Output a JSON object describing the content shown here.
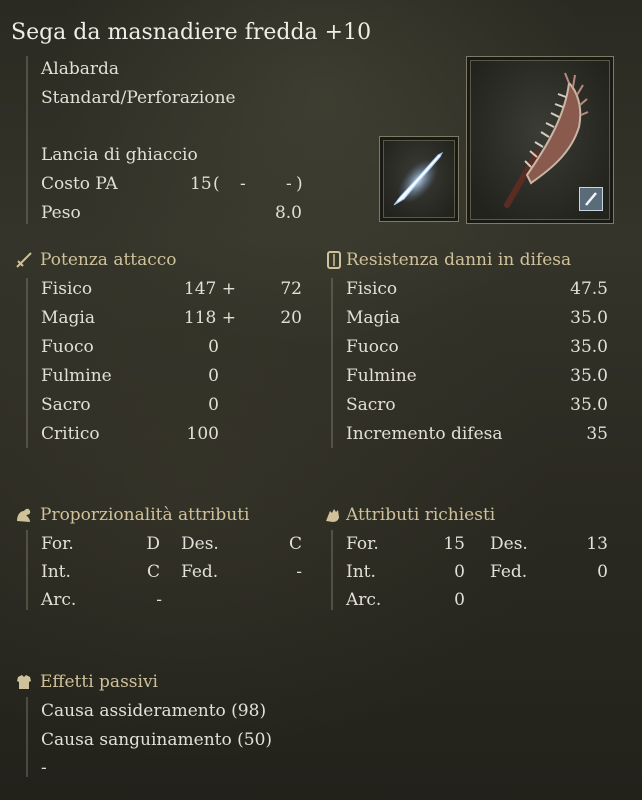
{
  "weapon": {
    "name": "Sega da masnadiere fredda +10",
    "type": "Alabarda",
    "damage_type": "Standard/Perforazione",
    "skill": "Lancia di ghiaccio",
    "fp_cost_label": "Costo PA",
    "fp_cost_value": "15",
    "fp_cost_paren_open": "(",
    "fp_cost_mid": "-",
    "fp_cost_end": "-",
    "fp_cost_paren_close": ")",
    "weight_label": "Peso",
    "weight_value": "8.0"
  },
  "attack": {
    "title": "Potenza attacco",
    "rows": [
      {
        "label": "Fisico",
        "value": "147 +",
        "bonus": "72"
      },
      {
        "label": "Magia",
        "value": "118 +",
        "bonus": "20"
      },
      {
        "label": "Fuoco",
        "value": "0",
        "bonus": ""
      },
      {
        "label": "Fulmine",
        "value": "0",
        "bonus": ""
      },
      {
        "label": "Sacro",
        "value": "0",
        "bonus": ""
      },
      {
        "label": "Critico",
        "value": "100",
        "bonus": ""
      }
    ]
  },
  "defense": {
    "title": "Resistenza danni in difesa",
    "rows": [
      {
        "label": "Fisico",
        "value": "47.5"
      },
      {
        "label": "Magia",
        "value": "35.0"
      },
      {
        "label": "Fuoco",
        "value": "35.0"
      },
      {
        "label": "Fulmine",
        "value": "35.0"
      },
      {
        "label": "Sacro",
        "value": "35.0"
      },
      {
        "label": "Incremento difesa",
        "value": "35"
      }
    ]
  },
  "scaling": {
    "title": "Proporzionalità attributi",
    "for_label": "For.",
    "for_value": "D",
    "des_label": "Des.",
    "des_value": "C",
    "int_label": "Int.",
    "int_value": "C",
    "fed_label": "Fed.",
    "fed_value": "-",
    "arc_label": "Arc.",
    "arc_value": "-"
  },
  "requirements": {
    "title": "Attributi richiesti",
    "for_label": "For.",
    "for_value": "15",
    "des_label": "Des.",
    "des_value": "13",
    "int_label": "Int.",
    "int_value": "0",
    "fed_label": "Fed.",
    "fed_value": "0",
    "arc_label": "Arc.",
    "arc_value": "0"
  },
  "passive": {
    "title": "Effetti passivi",
    "items": [
      "Causa assideramento (98)",
      "Causa sanguinamento (50)",
      "-"
    ]
  },
  "colors": {
    "section_title": "#cfc29a",
    "text": "#e2e0d6"
  },
  "icons": {
    "attack": "sword-icon",
    "defense": "shield-icon",
    "scaling": "flexed-arm-icon",
    "requirements": "hand-icon",
    "passive": "armor-icon",
    "skill": "ice-lance-icon",
    "weapon": "saw-halberd-icon",
    "weapon_badge": "sword-badge-icon"
  }
}
